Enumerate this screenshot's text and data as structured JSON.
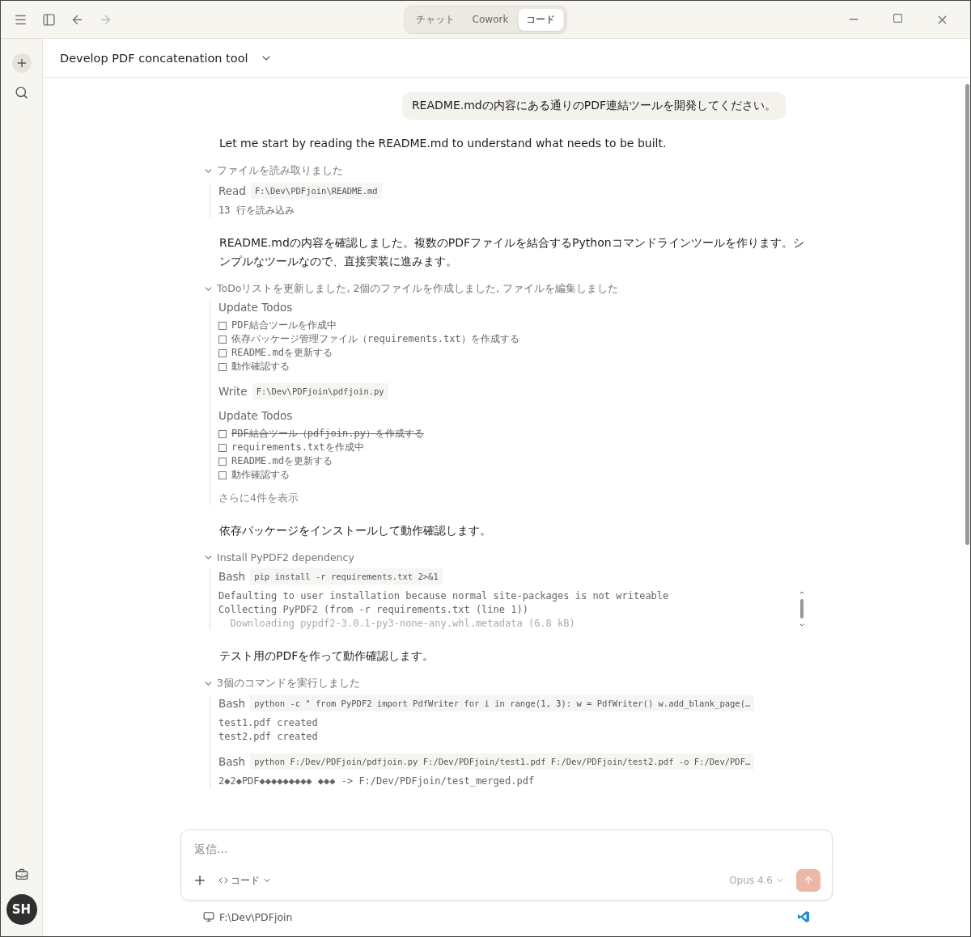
{
  "titlebar": {
    "modes": [
      {
        "label": "チャット",
        "selected": false
      },
      {
        "label": "Cowork",
        "selected": false
      },
      {
        "label": "コード",
        "selected": true
      }
    ]
  },
  "sidebar": {
    "avatar": "SH"
  },
  "header": {
    "title": "Develop PDF concatenation tool"
  },
  "messages": [
    {
      "kind": "user",
      "text": "README.mdの内容にある通りのPDF連結ツールを開発してください。"
    },
    {
      "kind": "assistant",
      "text": "Let me start by reading the README.md to understand what needs to be built."
    },
    {
      "kind": "group",
      "label": "ファイルを読み取りました",
      "expanded": true,
      "steps": [
        {
          "kind": "tool",
          "tool": "Read",
          "command": "F:\\Dev\\PDFjoin\\README.md",
          "note": "13 行を読み込み"
        }
      ]
    },
    {
      "kind": "assistant",
      "text": "README.mdの内容を確認しました。複数のPDFファイルを結合するPythonコマンドラインツールを作ります。シンプルなツールなので、直接実装に進みます。"
    },
    {
      "kind": "group",
      "label": "ToDoリストを更新しました, 2個のファイルを作成しました, ファイルを編集しました",
      "expanded": true,
      "steps": [
        {
          "kind": "todos",
          "tool": "Update Todos",
          "items": [
            {
              "text": "PDF結合ツールを作成中",
              "done": false
            },
            {
              "text": "依存パッケージ管理ファイル（requirements.txt）を作成する",
              "done": false
            },
            {
              "text": "README.mdを更新する",
              "done": false
            },
            {
              "text": "動作確認する",
              "done": false
            }
          ]
        },
        {
          "kind": "tool",
          "tool": "Write",
          "command": "F:\\Dev\\PDFjoin\\pdfjoin.py"
        },
        {
          "kind": "todos",
          "tool": "Update Todos",
          "items": [
            {
              "text": "PDF結合ツール（pdfjoin.py）を作成する",
              "done": true
            },
            {
              "text": "requirements.txtを作成中",
              "done": false
            },
            {
              "text": "README.mdを更新する",
              "done": false
            },
            {
              "text": "動作確認する",
              "done": false
            }
          ]
        },
        {
          "kind": "more",
          "text": "さらに4件を表示"
        }
      ]
    },
    {
      "kind": "assistant",
      "text": "依存パッケージをインストールして動作確認します。"
    },
    {
      "kind": "group",
      "label": "Install PyPDF2 dependency",
      "expanded": true,
      "steps": [
        {
          "kind": "tool",
          "tool": "Bash",
          "command": "pip install -r requirements.txt 2>&1",
          "scroll": true,
          "output": [
            "Defaulting to user installation because normal site-packages is not writeable",
            "Collecting PyPDF2 (from -r requirements.txt (line 1))",
            "  Downloading pypdf2-3.0.1-py3-none-any.whl.metadata (6.8 kB)"
          ]
        }
      ]
    },
    {
      "kind": "assistant",
      "text": "テスト用のPDFを作って動作確認します。"
    },
    {
      "kind": "group",
      "label": "3個のコマンドを実行しました",
      "expanded": true,
      "steps": [
        {
          "kind": "tool",
          "tool": "Bash",
          "command": "python -c \" from PyPDF2 import PdfWriter for i in range(1, 3): w = PdfWriter() w.add_blank_page(…",
          "output": [
            "test1.pdf created",
            "test2.pdf created"
          ]
        },
        {
          "kind": "tool",
          "tool": "Bash",
          "command": "python F:/Dev/PDFjoin/pdfjoin.py F:/Dev/PDFjoin/test1.pdf F:/Dev/PDFjoin/test2.pdf -o F:/Dev/PDF…",
          "output": [
            "2◆2◆PDF◆◆◆◆◆◆◆◆◆ ◆◆◆ -> F:/Dev/PDFjoin/test_merged.pdf"
          ]
        }
      ]
    }
  ],
  "composer": {
    "placeholder": "返信...",
    "mode": "コード",
    "model": "Opus 4.6"
  },
  "footer": {
    "path": "F:\\Dev\\PDFjoin"
  }
}
